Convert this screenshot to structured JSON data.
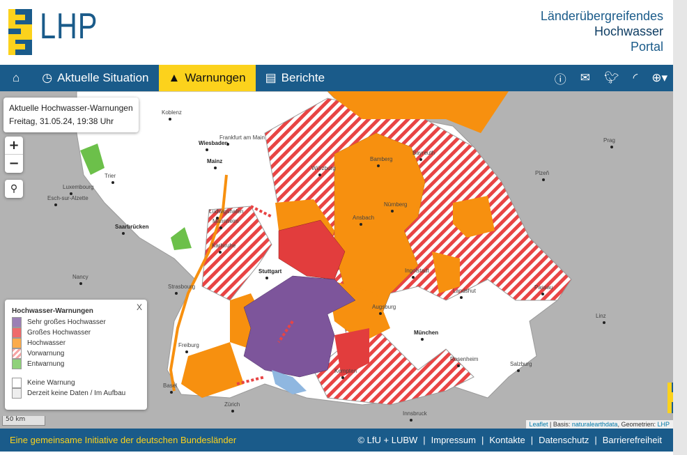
{
  "header": {
    "logo_text": "LHP",
    "title_line1": "Länderübergreifendes",
    "title_line2": "Hochwasser",
    "title_line3": "Portal"
  },
  "nav": {
    "items": [
      {
        "label": "Aktuelle Situation"
      },
      {
        "label": "Warnungen"
      },
      {
        "label": "Berichte"
      }
    ],
    "active": "Warnungen",
    "icons": [
      "home-icon",
      "info-icon",
      "mail-icon",
      "twitter-icon",
      "rss-icon",
      "globe-icon"
    ]
  },
  "infobox": {
    "title": "Aktuelle Hochwasser-Warnungen",
    "date": "Freitag, 31.05.24, 19:38 Uhr"
  },
  "zoom": {
    "in": "+",
    "out": "−",
    "search": "search-icon"
  },
  "legend": {
    "title": "Hochwasser-Warnungen",
    "close": "X",
    "items": [
      {
        "label": "Sehr großes Hochwasser",
        "color": "#9b7fb5"
      },
      {
        "label": "Großes Hochwasser",
        "color": "#ef6b6b"
      },
      {
        "label": "Hochwasser",
        "color": "#fbab4b"
      },
      {
        "label": "Vorwarnung",
        "color": "#f6a5a5"
      },
      {
        "label": "Entwarnung",
        "color": "#8fd17a"
      }
    ],
    "extra": [
      {
        "label": "Keine Warnung",
        "color": "#ffffff"
      },
      {
        "label": "Derzeit keine Daten / Im Aufbau",
        "color": "#eeeeee"
      }
    ]
  },
  "map": {
    "scale": "50 km",
    "colors": {
      "very_high": "#7d559b",
      "high": "#e23d3d",
      "flood": "#f7900f",
      "prewarn": "#e84444",
      "all_clear": "#6cc04a",
      "none": "#ffffff",
      "water": "#8fb7e0"
    },
    "cities": [
      {
        "name": "Koblenz"
      },
      {
        "name": "Frankfurt am Main"
      },
      {
        "name": "Wiesbaden"
      },
      {
        "name": "Mainz"
      },
      {
        "name": "Würzburg"
      },
      {
        "name": "Bamberg"
      },
      {
        "name": "Bayreuth"
      },
      {
        "name": "Prag"
      },
      {
        "name": "Plzeň"
      },
      {
        "name": "Luxembourg"
      },
      {
        "name": "Esch-sur-Alzette"
      },
      {
        "name": "Trier"
      },
      {
        "name": "Mannheim"
      },
      {
        "name": "Ludwigshafen"
      },
      {
        "name": "Nürnberg"
      },
      {
        "name": "Ansbach"
      },
      {
        "name": "Saarbrücken"
      },
      {
        "name": "Karlsruhe"
      },
      {
        "name": "Stuttgart"
      },
      {
        "name": "Ingolstadt"
      },
      {
        "name": "Nancy"
      },
      {
        "name": "Strasbourg"
      },
      {
        "name": "Landshut"
      },
      {
        "name": "Passau"
      },
      {
        "name": "Augsburg"
      },
      {
        "name": "Linz"
      },
      {
        "name": "München"
      },
      {
        "name": "Freiburg"
      },
      {
        "name": "Rosenheim"
      },
      {
        "name": "Salzburg"
      },
      {
        "name": "Kempten"
      },
      {
        "name": "Basel"
      },
      {
        "name": "Zürich"
      },
      {
        "name": "Innsbruck"
      }
    ]
  },
  "attribution": {
    "leaflet": "Leaflet",
    "sep1": " | Basis: ",
    "basis": "naturalearthdata",
    "sep2": ", Geometrien: ",
    "geom": "LHP"
  },
  "footer": {
    "left": "Eine gemeinsame Initiative der deutschen Bundesländer",
    "links": [
      "© LfU + LUBW",
      "Impressum",
      "Kontakte",
      "Datenschutz",
      "Barrierefreiheit"
    ]
  }
}
